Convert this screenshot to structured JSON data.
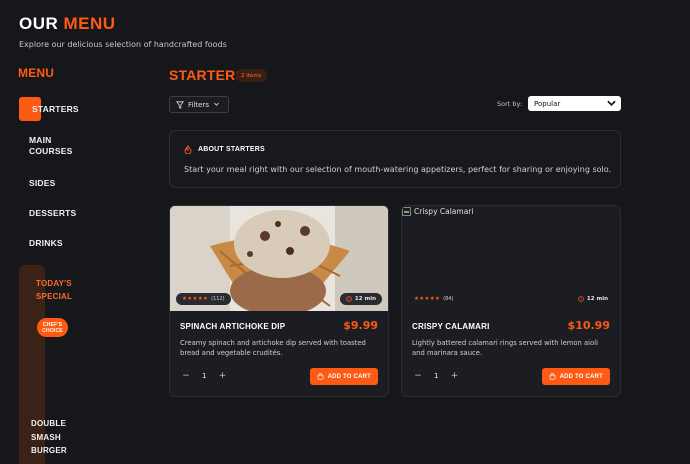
{
  "header": {
    "title_word1": "OUR",
    "title_word2": "MENU",
    "subtitle": "Explore our delicious selection of handcrafted foods"
  },
  "sidebar": {
    "title": "MENU",
    "items": [
      {
        "label": "STARTERS",
        "active": true
      },
      {
        "label": "MAIN COURSES"
      },
      {
        "label": "SIDES"
      },
      {
        "label": "DESSERTS"
      },
      {
        "label": "DRINKS"
      }
    ],
    "special": {
      "label": "TODAY'S SPECIAL",
      "badge": "CHEF'S CHOICE",
      "item": "DOUBLE SMASH BURGER"
    }
  },
  "main": {
    "section_title": "STARTERS",
    "items_badge": "2 items",
    "filters_label": "Filters",
    "sort_label": "Sort by:",
    "sort_value": "Popular",
    "about": {
      "title": "ABOUT STARTERS",
      "text": "Start your meal right with our selection of mouth-watering appetizers, perfect for sharing or enjoying solo."
    },
    "cards": [
      {
        "name": "SPINACH ARTICHOKE DIP",
        "price": "$9.99",
        "rating_stars": "★★★★★",
        "rating_count": "(112)",
        "time": "12 min",
        "description": "Creamy spinach and artichoke dip served with toasted bread and vegetable crudités.",
        "quantity": "1",
        "add_label": "ADD TO CART"
      },
      {
        "name": "CRISPY CALAMARI",
        "price": "$10.99",
        "image_alt": "Crispy Calamari",
        "rating_stars": "★★★★★",
        "rating_count": "(84)",
        "time": "12 min",
        "description": "Lightly battered calamari rings served with lemon aioli and marinara sauce.",
        "quantity": "1",
        "add_label": "ADD TO CART"
      }
    ]
  },
  "colors": {
    "accent": "#ff5a14",
    "background": "#16171b",
    "card": "#1c1d23"
  }
}
